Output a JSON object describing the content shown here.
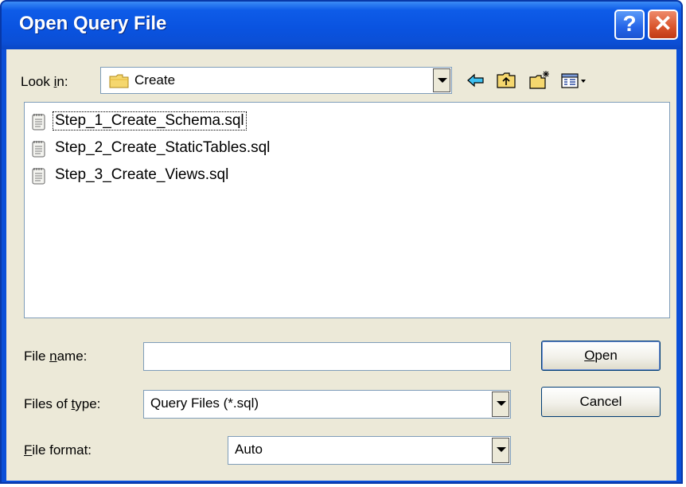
{
  "window": {
    "title": "Open Query File",
    "help_glyph": "?",
    "close_glyph": "✕"
  },
  "look_in": {
    "label_pre": "Look ",
    "label_key": "i",
    "label_post": "n:",
    "value": "Create",
    "icon": "folder-icon"
  },
  "toolbar": {
    "icons": [
      "back-arrow-icon",
      "up-folder-icon",
      "new-folder-icon",
      "view-menu-icon"
    ]
  },
  "files": [
    {
      "name": "Step_1_Create_Schema.sql",
      "icon": "sql-file-icon",
      "focused": true
    },
    {
      "name": "Step_2_Create_StaticTables.sql",
      "icon": "sql-file-icon",
      "focused": false
    },
    {
      "name": "Step_3_Create_Views.sql",
      "icon": "sql-file-icon",
      "focused": false
    }
  ],
  "file_name": {
    "label_pre": "File ",
    "label_key": "n",
    "label_post": "ame:",
    "value": ""
  },
  "files_of_type": {
    "label_pre": "Files of ",
    "label_key": "t",
    "label_post": "ype:",
    "value": "Query Files (*.sql)"
  },
  "file_format": {
    "label_pre": "",
    "label_key": "F",
    "label_post": "ile format:",
    "value": "Auto"
  },
  "buttons": {
    "open_key": "O",
    "open_rest": "pen",
    "cancel": "Cancel"
  }
}
